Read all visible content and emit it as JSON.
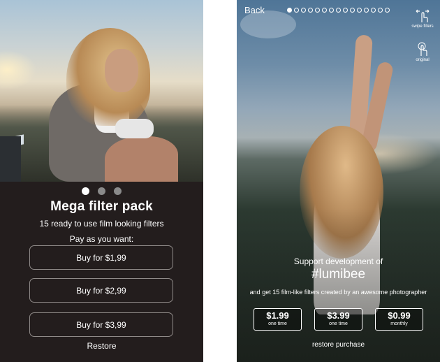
{
  "left_screen": {
    "pager_dots": [
      {
        "active": true
      },
      {
        "active": false
      },
      {
        "active": false
      }
    ],
    "title": "Mega filter pack",
    "subtitle": "15 ready to use film looking filters",
    "pay_label": "Pay as you want:",
    "buy_buttons": [
      "Buy for $1,99",
      "Buy for $2,99",
      "Buy for $3,99"
    ],
    "restore_label": "Restore"
  },
  "right_screen": {
    "back_label": "Back",
    "pager_dot_count": 15,
    "gestures": {
      "swipe_filters_label": "swipe filters",
      "original_label": "original"
    },
    "support_text": "Support development of",
    "hashtag": "#lumibee",
    "filters_text": "and get 15 film-like filters created by an awesome photographer",
    "prices": [
      {
        "amount": "$1.99",
        "term": "one time"
      },
      {
        "amount": "$3.99",
        "term": "one time"
      },
      {
        "amount": "$0.99",
        "term": "monthly"
      }
    ],
    "restore_label": "restore purchase"
  },
  "colors": {
    "left_panel_bg": "#231d1d",
    "button_border": "#8f8a88",
    "text": "#ffffff"
  }
}
